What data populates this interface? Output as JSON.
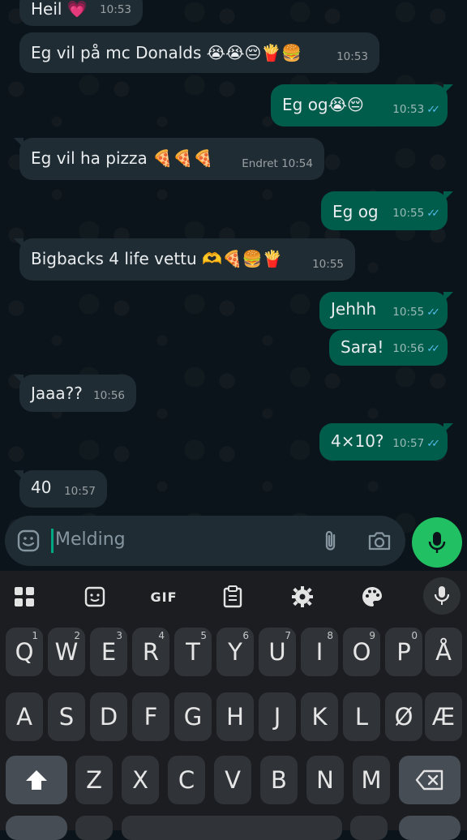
{
  "messages": [
    {
      "side": "in",
      "text": "Heil 💗",
      "time": "10:53"
    },
    {
      "side": "in",
      "text": "Eg vil på mc Donalds 😭😭😔🍟🍔",
      "time": "10:53"
    },
    {
      "side": "out",
      "text": "Eg og😭😔",
      "time": "10:53"
    },
    {
      "side": "in",
      "text": "Eg vil ha pizza 🍕🍕🍕",
      "time": "Endret 10:54"
    },
    {
      "side": "out",
      "text": "Eg og",
      "time": "10:55"
    },
    {
      "side": "in",
      "text": "Bigbacks 4 life vettu 🫶🍕🍔🍟",
      "time": "10:55"
    },
    {
      "side": "out",
      "text": "Jehhh",
      "time": "10:55"
    },
    {
      "side": "out",
      "text": "Sara!",
      "time": "10:56"
    },
    {
      "side": "in",
      "text": "Jaaa??",
      "time": "10:56"
    },
    {
      "side": "out",
      "text": "4×10?",
      "time": "10:57"
    },
    {
      "side": "in",
      "text": "40",
      "time": "10:57"
    }
  ],
  "read_tick": "✓✓",
  "input": {
    "placeholder": "Melding"
  },
  "keyboard": {
    "toolbar_gif": "GIF",
    "row1": [
      {
        "k": "Q",
        "h": "1"
      },
      {
        "k": "W",
        "h": "2"
      },
      {
        "k": "E",
        "h": "3"
      },
      {
        "k": "R",
        "h": "4"
      },
      {
        "k": "T",
        "h": "5"
      },
      {
        "k": "Y",
        "h": "6"
      },
      {
        "k": "U",
        "h": "7"
      },
      {
        "k": "I",
        "h": "8"
      },
      {
        "k": "O",
        "h": "9"
      },
      {
        "k": "P",
        "h": "0"
      },
      {
        "k": "Å",
        "h": ""
      }
    ],
    "row2": [
      "A",
      "S",
      "D",
      "F",
      "G",
      "H",
      "J",
      "K",
      "L",
      "Ø",
      "Æ"
    ],
    "row3": [
      "Z",
      "X",
      "C",
      "V",
      "B",
      "N",
      "M"
    ]
  },
  "colors": {
    "incoming": "#202c33",
    "outgoing": "#005c4b",
    "accent": "#21c063",
    "tick": "#53bdeb"
  }
}
